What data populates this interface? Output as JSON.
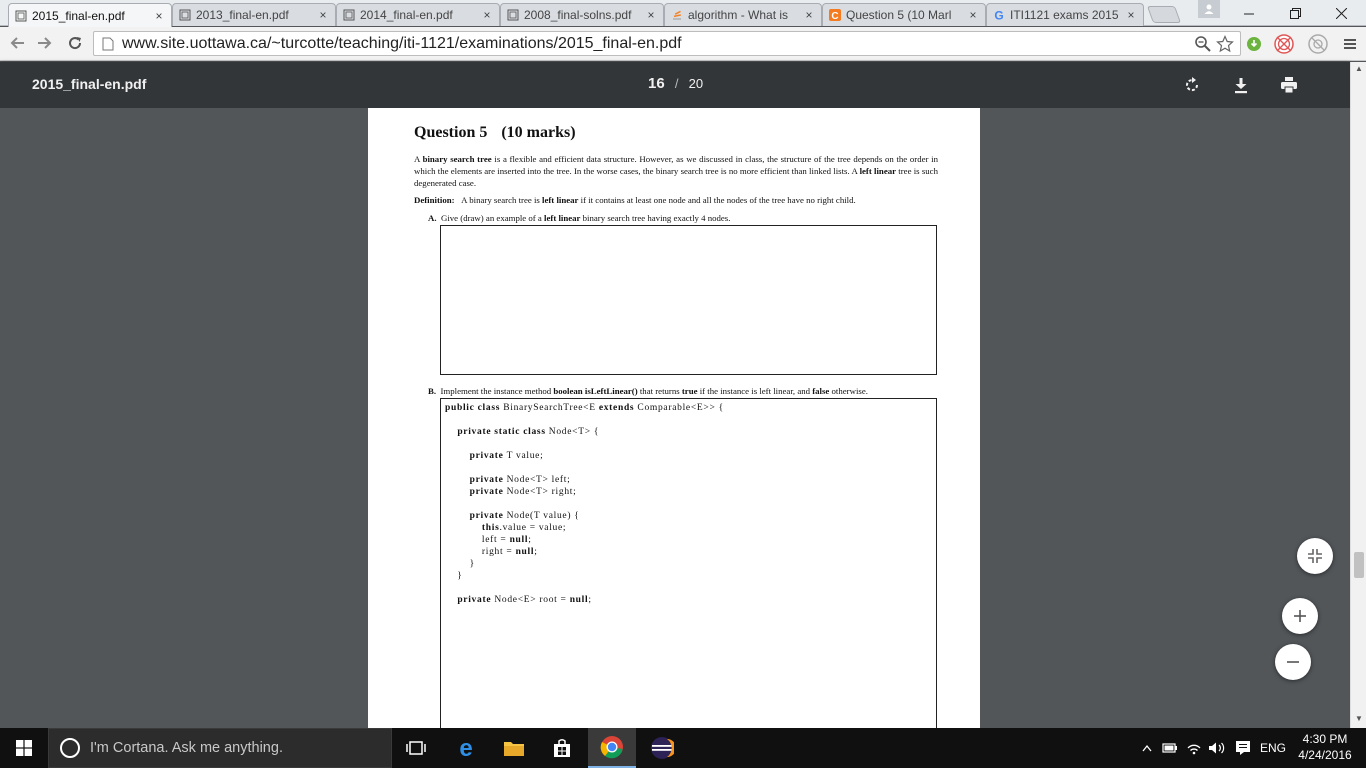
{
  "browser": {
    "tabs": [
      {
        "title": "2015_final-en.pdf",
        "active": true
      },
      {
        "title": "2013_final-en.pdf",
        "active": false
      },
      {
        "title": "2014_final-en.pdf",
        "active": false
      },
      {
        "title": "2008_final-solns.pdf",
        "active": false
      },
      {
        "title": "algorithm - What is",
        "active": false
      },
      {
        "title": "Question 5 (10 Marl",
        "active": false
      },
      {
        "title": "ITI1121 exams 2015",
        "active": false
      }
    ],
    "tab_close_glyph": "×",
    "url": "www.site.uottawa.ca/~turcotte/teaching/iti-1121/examinations/2015_final-en.pdf"
  },
  "pdf_viewer": {
    "doc_name": "2015_final-en.pdf",
    "current_page": "16",
    "separator": "/",
    "total_pages": "20"
  },
  "document": {
    "question_title": "Question 5",
    "question_marks": "(10 marks)",
    "intro": {
      "p1": "A ",
      "b1": "binary search tree",
      "p2": " is a flexible and efficient data structure. However, as we discussed in class, the structure of the tree depends on the order in which the elements are inserted into the tree. In the worse cases, the binary search tree is no more efficient than linked lists. A ",
      "b2": "left linear",
      "p3": " tree is such degenerated case."
    },
    "definition": {
      "label": "Definition:",
      "p1": "A binary search tree is ",
      "b1": "left linear",
      "p2": " if it contains at least one node and all the nodes of the tree have no right child."
    },
    "part_a": {
      "label": "A.",
      "p1": "Give (draw) an example of a ",
      "b1": "left linear",
      "p2": " binary search tree having exactly 4 nodes."
    },
    "part_b": {
      "label": "B.",
      "p1": "Implement the instance method ",
      "b1": "boolean isLeftLinear()",
      "p2": " that returns ",
      "b2": "true",
      "p3": " if the instance is left linear, and ",
      "b3": "false",
      "p4": " otherwise."
    },
    "code_lines": [
      [
        {
          "k": "public class "
        },
        {
          "t": "BinarySearchTree<E "
        },
        {
          "k": "extends "
        },
        {
          "t": "Comparable<E>> {"
        }
      ],
      [],
      [
        {
          "t": "    "
        },
        {
          "k": "private static class "
        },
        {
          "t": "Node<T> {"
        }
      ],
      [],
      [
        {
          "t": "        "
        },
        {
          "k": "private "
        },
        {
          "t": "T value;"
        }
      ],
      [],
      [
        {
          "t": "        "
        },
        {
          "k": "private "
        },
        {
          "t": "Node<T> left;"
        }
      ],
      [
        {
          "t": "        "
        },
        {
          "k": "private "
        },
        {
          "t": "Node<T> right;"
        }
      ],
      [],
      [
        {
          "t": "        "
        },
        {
          "k": "private "
        },
        {
          "t": "Node(T value) {"
        }
      ],
      [
        {
          "t": "            "
        },
        {
          "k": "this"
        },
        {
          "t": ".value = value;"
        }
      ],
      [
        {
          "t": "            left = "
        },
        {
          "k": "null"
        },
        {
          "t": ";"
        }
      ],
      [
        {
          "t": "            right = "
        },
        {
          "k": "null"
        },
        {
          "t": ";"
        }
      ],
      [
        {
          "t": "        }"
        }
      ],
      [
        {
          "t": "    }"
        }
      ],
      [],
      [
        {
          "t": "    "
        },
        {
          "k": "private "
        },
        {
          "t": "Node<E> root = "
        },
        {
          "k": "null"
        },
        {
          "t": ";"
        }
      ]
    ]
  },
  "taskbar": {
    "cortana_placeholder": "I'm Cortana. Ask me anything.",
    "language": "ENG",
    "time": "4:30 PM",
    "date": "4/24/2016"
  }
}
